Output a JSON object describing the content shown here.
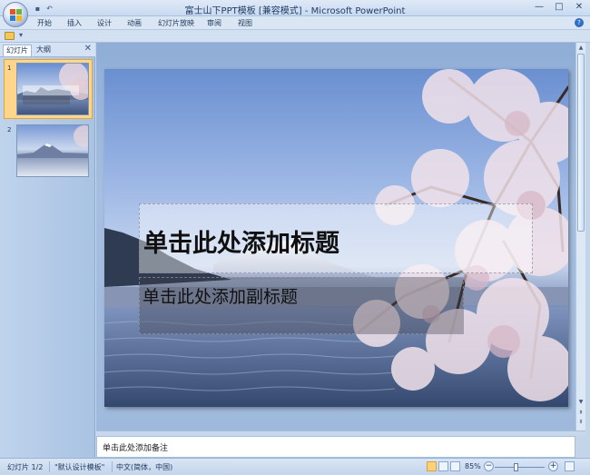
{
  "window": {
    "title": "富士山下PPT模板 [兼容模式] - Microsoft PowerPoint",
    "minimize": "—",
    "maximize": "□",
    "close": "✕"
  },
  "ribbon": {
    "tabs": [
      {
        "label": "开始"
      },
      {
        "label": "插入"
      },
      {
        "label": "设计"
      },
      {
        "label": "动画"
      },
      {
        "label": "幻灯片放映"
      },
      {
        "label": "审阅"
      },
      {
        "label": "视图"
      }
    ],
    "help": "?"
  },
  "quick_access": {
    "dropdown": "▾"
  },
  "left_pane": {
    "tabs": [
      {
        "label": "幻灯片"
      },
      {
        "label": "大纲"
      }
    ],
    "close": "✕",
    "slides": [
      {
        "number": "1",
        "selected": true
      },
      {
        "number": "2",
        "selected": false
      }
    ]
  },
  "slide": {
    "title_placeholder": "单击此处添加标题",
    "subtitle_placeholder": "单击此处添加副标题"
  },
  "notes": {
    "placeholder": "单击此处添加备注"
  },
  "statusbar": {
    "slide_count": "幻灯片 1/2",
    "theme": "\"默认设计模板\"",
    "language": "中文(简体，中国)",
    "zoom": "85%",
    "zoom_minus": "−",
    "zoom_plus": "+"
  },
  "colors": {
    "accent": "#f6a41c",
    "ribbon_bg": "#dbe6f4",
    "pane_bg": "#a9c3e3"
  }
}
